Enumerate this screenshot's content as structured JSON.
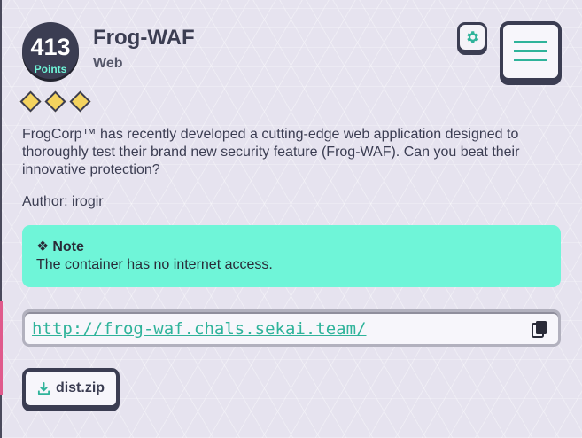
{
  "challenge": {
    "points": "413",
    "points_label": "Points",
    "title": "Frog-WAF",
    "category": "Web",
    "difficulty_level": 3,
    "description": "FrogCorp™ has recently developed a cutting-edge web application designed to thoroughly test their brand new security feature (Frog-WAF). Can you beat their innovative protection?",
    "author": "Author: irogir"
  },
  "note": {
    "symbol": "❖",
    "title": "Note",
    "body": "The container has no internet access."
  },
  "connection": {
    "url": "http://frog-waf.chals.sekai.team/"
  },
  "attachment": {
    "label": "dist.zip"
  },
  "icons": {
    "settings": "gear-icon",
    "menu": "hamburger-menu-icon",
    "copy": "clipboard-copy-icon",
    "download": "download-icon",
    "difficulty": "diamond-icon"
  },
  "colors": {
    "accent": "#6ff5d8",
    "dark": "#3b3d52",
    "difficulty": "#f4d35e",
    "link": "#2fb39a"
  }
}
